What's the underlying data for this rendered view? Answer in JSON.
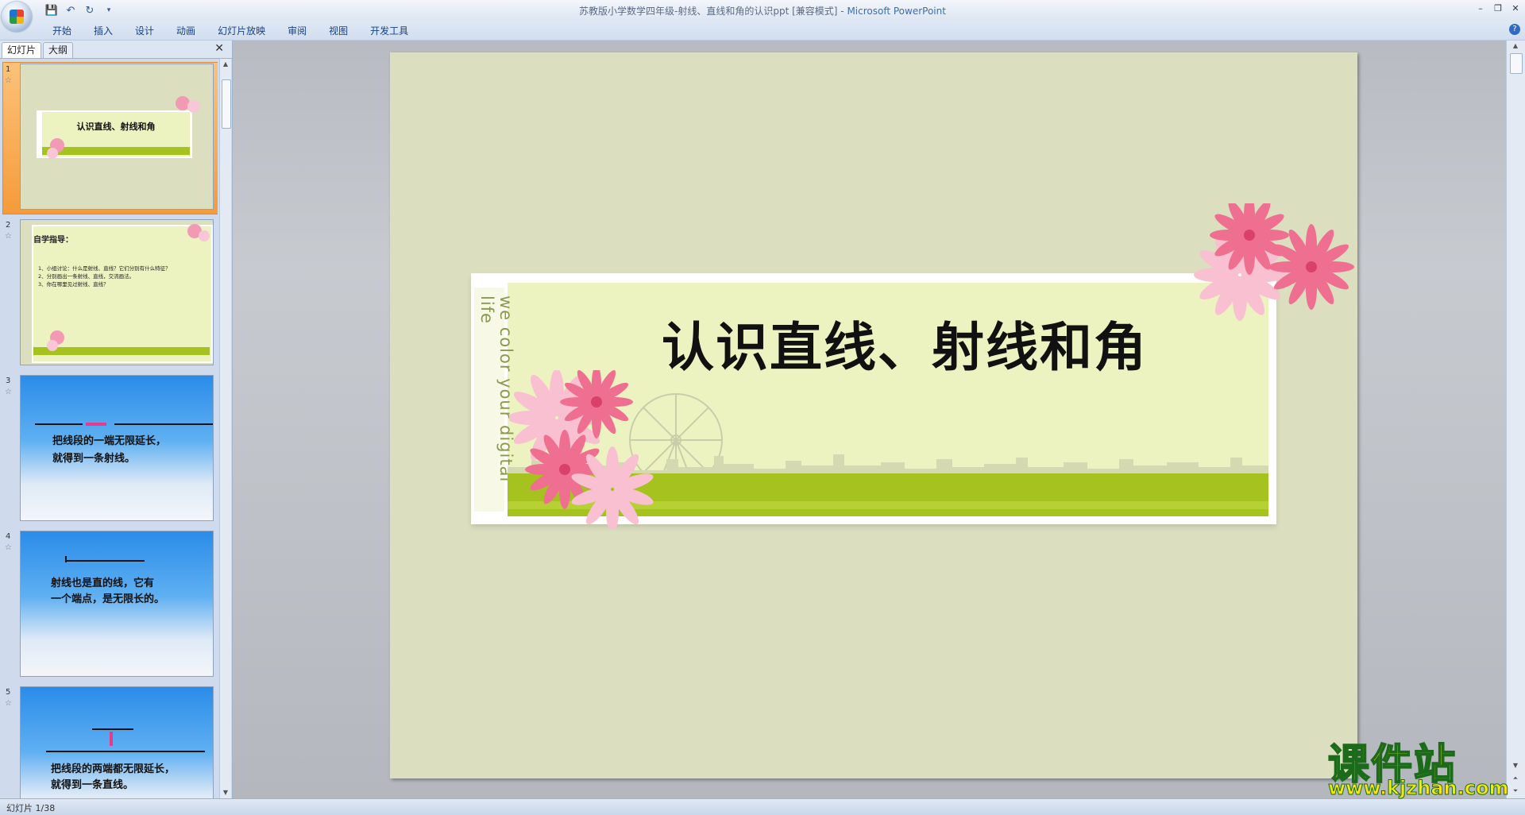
{
  "window": {
    "title": "苏教版小学数学四年级-射线、直线和角的认识ppt [兼容模式]",
    "separator": " - ",
    "app_name": "Microsoft PowerPoint"
  },
  "qat": {
    "save": "💾",
    "undo": "↶",
    "redo": "↻",
    "more": "▾"
  },
  "ribbon": {
    "tabs": [
      "开始",
      "插入",
      "设计",
      "动画",
      "幻灯片放映",
      "审阅",
      "视图",
      "开发工具"
    ],
    "help": "?"
  },
  "pane": {
    "tab_slides": "幻灯片",
    "tab_outline": "大纲",
    "close": "✕"
  },
  "thumbnails": [
    {
      "num": "1",
      "title": "认识直线、射线和角"
    },
    {
      "num": "2",
      "heading": "自学指导：",
      "items": [
        "1、小组讨论：什么是射线、直线？它们分别有什么特征？",
        "2、分别画出一条射线、直线，交流画法。",
        "3、你在哪里见过射线、直线？"
      ]
    },
    {
      "num": "3",
      "line1": "把线段的一端无限延长，",
      "line2": "就得到一条射线。"
    },
    {
      "num": "4",
      "line1": "射线也是直的线，它有",
      "line2": "一个端点，是无限长的。"
    },
    {
      "num": "5",
      "line1": "把线段的两端都无限延长，",
      "line2": "就得到一条直线。"
    }
  ],
  "slide": {
    "title": "认识直线、射线和角",
    "tagline": "we color your digital life"
  },
  "status": {
    "text": "幻灯片 1/38"
  },
  "watermark": {
    "cn": "课件站",
    "url": "www.kjzhan.com"
  },
  "colors": {
    "slide_bg": "#dcdfbf",
    "banner_inner": "#edf3c0",
    "green_band": "#a5c21f",
    "selected_thumb": "#f59b3a",
    "thumb_blue_top": "#2a8ce8"
  }
}
